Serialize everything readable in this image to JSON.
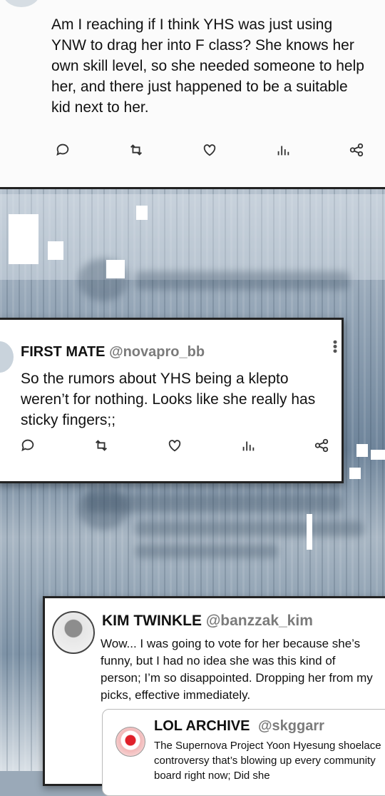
{
  "top_tweet": {
    "text": "Am I reaching if I think YHS was just using YNW to drag her into F class? She knows her own skill level, so she needed someone to help her, and there just happened to be a suitable kid next to her."
  },
  "mid_tweet": {
    "name": "FIRST MATE",
    "handle": "@novapro_bb",
    "text": "So the rumors about YHS being a klepto weren’t for nothing. Looks like she really has sticky fingers;;"
  },
  "bottom_tweet": {
    "name": "KIM TWINKLE",
    "handle": "@banzzak_kim",
    "text": "Wow... I was going to vote for her because she’s funny, but I had no idea she was this kind of person; I’m so disappointed. Dropping her from my picks, effective immediately.",
    "quote": {
      "name": "LOL ARCHIVE",
      "handle": "@skggarr",
      "text": "The Supernova Project Yoon Hyesung shoelace controversy that’s blowing up every community board right now; Did she"
    }
  },
  "icons": [
    "reply-icon",
    "retweet-icon",
    "like-icon",
    "stats-icon",
    "share-icon",
    "more-icon"
  ],
  "colors": {
    "card": "#ffffff",
    "border": "#222222",
    "handle": "#7b7b7b",
    "icon": "#333333"
  }
}
